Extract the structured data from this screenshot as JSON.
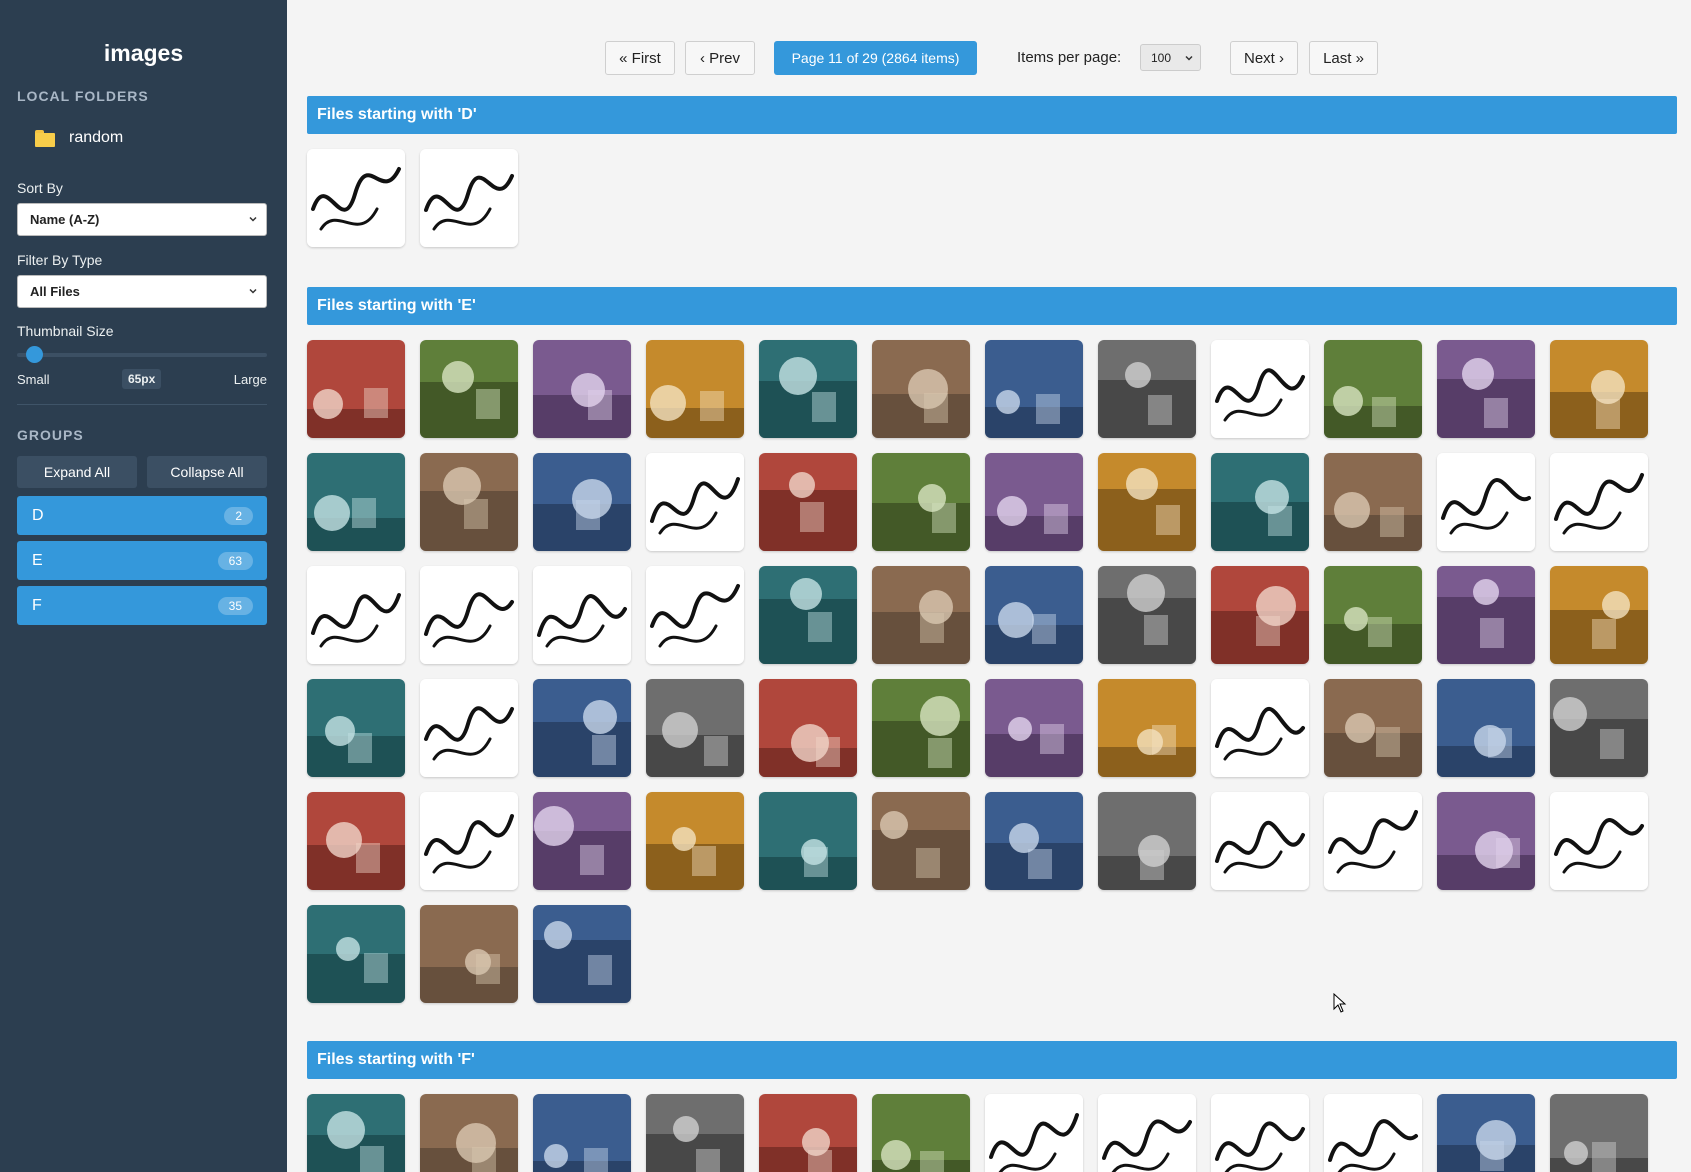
{
  "sidebar": {
    "title": "images",
    "local_folders_label": "LOCAL FOLDERS",
    "folder": {
      "name": "random",
      "icon": "folder-icon"
    },
    "sort_label": "Sort By",
    "sort_value": "Name (A-Z)",
    "filter_label": "Filter By Type",
    "filter_value": "All Files",
    "thumb_label": "Thumbnail Size",
    "thumb_small": "Small",
    "thumb_value": "65px",
    "thumb_large": "Large",
    "groups_label": "GROUPS",
    "expand_all": "Expand All",
    "collapse_all": "Collapse All",
    "groups": [
      {
        "letter": "D",
        "count": "2"
      },
      {
        "letter": "E",
        "count": "63"
      },
      {
        "letter": "F",
        "count": "35"
      }
    ]
  },
  "pager": {
    "first": "« First",
    "prev": "‹ Prev",
    "info": "Page 11 of 29 (2864 items)",
    "per_page_label": "Items per page:",
    "per_page_value": "100",
    "next": "Next ›",
    "last": "Last »"
  },
  "sections": {
    "d": {
      "title": "Files starting with 'D'"
    },
    "e": {
      "title": "Files starting with 'E'"
    },
    "f": {
      "title": "Files starting with 'F'"
    }
  },
  "colors": {
    "sidebar": "#2c3e50",
    "accent": "#3498db",
    "background": "#f4f4f4"
  },
  "thumbnails": {
    "d": [
      "sk",
      "sk"
    ],
    "e": [
      "ph",
      "ph",
      "ph",
      "ph",
      "ph",
      "ph",
      "ph",
      "ph",
      "sk",
      "ph",
      "ph",
      "ph",
      "ph",
      "ph",
      "ph",
      "sk",
      "ph",
      "ph",
      "ph",
      "ph",
      "ph",
      "ph",
      "sk",
      "sk",
      "sk",
      "sk",
      "sk",
      "sk",
      "ph",
      "ph",
      "ph",
      "ph",
      "ph",
      "ph",
      "ph",
      "ph",
      "ph",
      "sk",
      "ph",
      "ph",
      "ph",
      "ph",
      "ph",
      "ph",
      "sk",
      "ph",
      "ph",
      "ph",
      "ph",
      "sk",
      "ph",
      "ph",
      "ph",
      "ph",
      "ph",
      "ph",
      "sk",
      "sk",
      "ph",
      "sk",
      "ph",
      "ph",
      "ph"
    ],
    "f": [
      "ph",
      "ph",
      "ph",
      "ph",
      "ph",
      "ph",
      "sk",
      "sk",
      "sk",
      "sk",
      "ph",
      "ph"
    ]
  }
}
